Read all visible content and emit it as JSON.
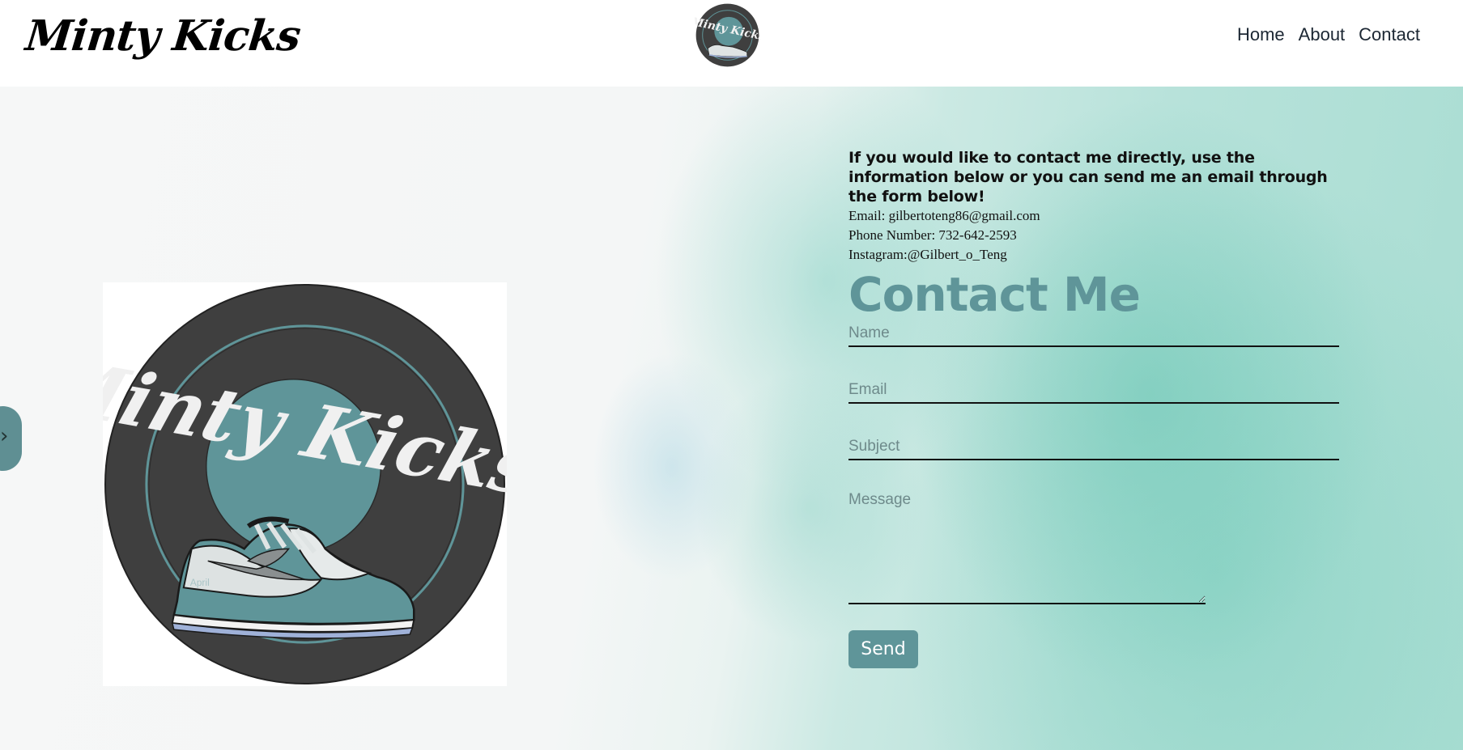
{
  "header": {
    "brand": "Minty Kicks",
    "logo_text": "Minty Kicks",
    "nav": [
      {
        "label": "Home"
      },
      {
        "label": "About"
      },
      {
        "label": "Contact"
      }
    ]
  },
  "side_tab": {
    "glyph": "›"
  },
  "hero_logo": {
    "text": "Minty Kicks",
    "shoe_tag": "April"
  },
  "contact": {
    "intro": "If you would like to contact me directly, use the information below or you can send me an email through the form below!",
    "email_line": "Email: gilbertoteng86@gmail.com",
    "phone_line": "Phone Number: 732-642-2593",
    "instagram_line": "Instagram:@Gilbert_o_Teng",
    "title": "Contact Me",
    "fields": {
      "name_placeholder": "Name",
      "email_placeholder": "Email",
      "subject_placeholder": "Subject",
      "message_placeholder": "Message"
    },
    "send_label": "Send"
  },
  "colors": {
    "accent": "#5f9599",
    "logo_dark": "#3f3f3f",
    "logo_teal": "#5f9599",
    "bg_mint": "#a8ddd2"
  }
}
